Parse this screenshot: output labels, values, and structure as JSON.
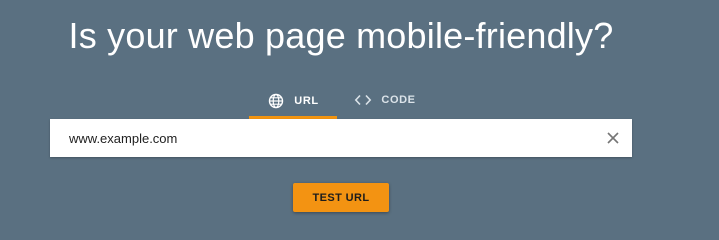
{
  "headline": "Is your web page mobile-friendly?",
  "tabs": [
    {
      "label": "URL",
      "icon": "globe-icon",
      "selected": true
    },
    {
      "label": "CODE",
      "icon": "code-icon",
      "selected": false
    }
  ],
  "url_input": {
    "value": "www.example.com"
  },
  "test_button": {
    "label": "TEST URL"
  },
  "colors": {
    "background": "#5a7081",
    "accent": "#f29410",
    "text_on_dark": "#ffffff"
  }
}
